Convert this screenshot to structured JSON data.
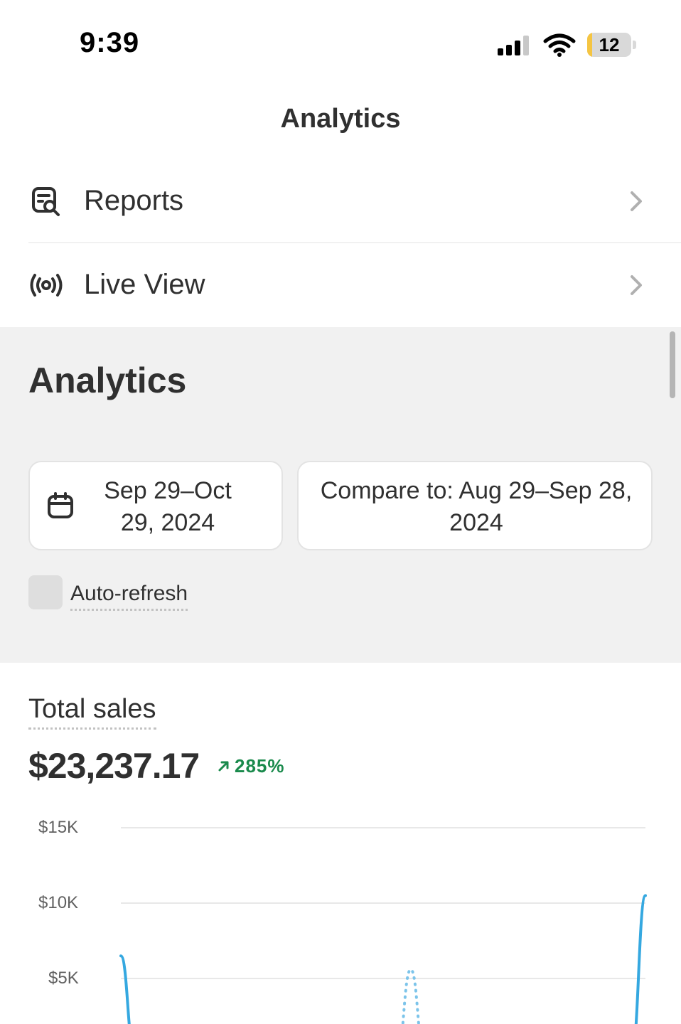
{
  "status_bar": {
    "time": "9:39",
    "battery_level": "12",
    "icons": [
      "signal-icon",
      "wifi-icon",
      "battery-icon"
    ]
  },
  "header": {
    "title": "Analytics"
  },
  "menu": {
    "items": [
      {
        "label": "Reports",
        "icon": "report-search-icon"
      },
      {
        "label": "Live View",
        "icon": "broadcast-icon"
      }
    ]
  },
  "analytics": {
    "title": "Analytics",
    "date_range": "Sep 29–Oct 29, 2024",
    "compare": "Compare to: Aug 29–Sep 28, 2024",
    "auto_refresh_label": "Auto-refresh",
    "auto_refresh_checked": false
  },
  "total_sales": {
    "title": "Total sales",
    "value": "$23,237.17",
    "change": "285%",
    "change_direction": "up",
    "change_color": "#1a8a4c"
  },
  "colors": {
    "series_current": "#35a8e0",
    "series_compare": "#7cc4ea",
    "gridline": "#e8e8e8",
    "section_bg": "#f1f1f1"
  },
  "chart_data": {
    "type": "line",
    "title": "",
    "xlabel": "",
    "ylabel": "",
    "y_ticks": [
      "$15K",
      "$10K",
      "$5K"
    ],
    "ylim": [
      0,
      15000
    ],
    "series": [
      {
        "style": "solid",
        "points": [
          [
            0,
            6500
          ],
          [
            1,
            0
          ],
          [
            22,
            0
          ],
          [
            23,
            900
          ],
          [
            24,
            0
          ],
          [
            29,
            0
          ],
          [
            30,
            1200
          ],
          [
            31,
            0
          ],
          [
            37,
            0
          ],
          [
            38,
            10500
          ]
        ]
      },
      {
        "style": "dotted",
        "points": [
          [
            20,
            0
          ],
          [
            21,
            5600
          ],
          [
            22,
            0
          ]
        ]
      }
    ]
  }
}
